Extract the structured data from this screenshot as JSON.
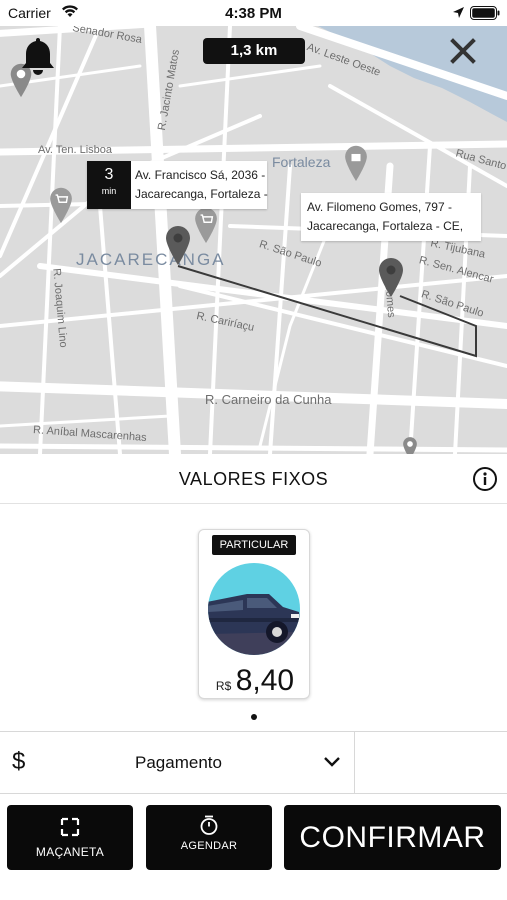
{
  "status_bar": {
    "carrier": "Carrier",
    "time": "4:38 PM"
  },
  "map": {
    "distance": "1,3 km",
    "district": "JACARECANGA",
    "city_label": "Fortaleza",
    "streets": [
      "Senador Rosa",
      "R. Jacinto Matos",
      "Av. Leste Oeste",
      "Av. Ten. Lisboa",
      "Rua Santo",
      "R. São Paulo",
      "R. Sen. Alencar",
      "R. Tijubana",
      "R. São Paulo",
      "R. Joaquim Lino",
      "R. Cariríaçu",
      "R. Carneiro da Cunha",
      "R. Aníbal Mascarenhas",
      "Gomes"
    ],
    "origin": {
      "eta_value": "3",
      "eta_unit": "min",
      "address_line1": "Av. Francisco Sá, 2036 -",
      "address_line2": "Jacarecanga, Fortaleza -"
    },
    "destination": {
      "address_line1": "Av. Filomeno Gomes, 797 -",
      "address_line2": "Jacarecanga, Fortaleza - CE,"
    },
    "route_color": "#3a3a3a",
    "water_color": "#b7c9da"
  },
  "fares": {
    "title": "VALORES FIXOS",
    "vehicles": [
      {
        "tag": "PARTICULAR",
        "currency": "R$",
        "price": "8,40"
      }
    ]
  },
  "payment": {
    "icon": "$",
    "label": "Pagamento"
  },
  "actions": {
    "macaneta": "MAÇANETA",
    "agendar": "AGENDAR",
    "confirm": "CONFIRMAR"
  }
}
